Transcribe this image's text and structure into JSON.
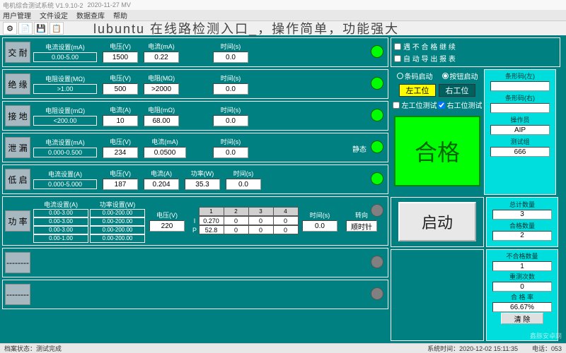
{
  "window": {
    "title": "电机综合测试系统 V1.9.10-2",
    "date": "2020-11-27 MV"
  },
  "menu": {
    "user": "用户管理",
    "file": "文件设定",
    "data": "数据查库",
    "help": "帮助"
  },
  "banner": "lubuntu 在线路检测入口_，操作简单，功能强大",
  "rows": {
    "jiaonai": {
      "name": "交 耐",
      "set_lbl": "电流设置(mA)",
      "set_val": "0.00-5.00",
      "volt_lbl": "电压(V)",
      "volt": "1500",
      "cur_lbl": "电流(mA)",
      "cur": "0.22",
      "time_lbl": "时间(s)",
      "time": "0.0"
    },
    "jueyuan": {
      "name": "绝 缘",
      "set_lbl": "电阻设置(MΩ)",
      "set_val": ">1.00",
      "volt_lbl": "电压(V)",
      "volt": "500",
      "res_lbl": "电阻(MΩ)",
      "res": ">2000",
      "time_lbl": "时间(s)",
      "time": "0.0"
    },
    "jiedi": {
      "name": "接 地",
      "set_lbl": "电阻设置(mΩ)",
      "set_val": "<200.00",
      "cur_lbl": "电流(A)",
      "cur": "10",
      "res_lbl": "电阻(mΩ)",
      "res": "68.00",
      "time_lbl": "时间(s)",
      "time": "0.0"
    },
    "xielou": {
      "name": "泄 漏",
      "set_lbl": "电流设置(mA)",
      "set_val": "0.000-0.500",
      "volt_lbl": "电压(V)",
      "volt": "234",
      "cur_lbl": "电流(mA)",
      "cur": "0.0500",
      "time_lbl": "时间(s)",
      "time": "0.0",
      "static": "静态"
    },
    "diqi": {
      "name": "低 启",
      "set_lbl": "电流设置(A)",
      "set_val": "0.000-5.000",
      "volt_lbl": "电压(V)",
      "volt": "187",
      "cur_lbl": "电流(A)",
      "cur": "0.204",
      "pow_lbl": "功率(W)",
      "pow": "35.3",
      "time_lbl": "时间(s)",
      "time": "0.0"
    },
    "gonglv": {
      "name": "功 率",
      "sets": {
        "c_lbl": "电流设置(A)",
        "p_lbl": "功率设置(W)",
        "r1c": "0.00-3.00",
        "r1p": "0.00-200.00",
        "r2c": "0.00-3.00",
        "r2p": "0.00-200.00",
        "r3c": "0.00-3.00",
        "r3p": "0.00-200.00",
        "r4c": "0.00-1.00",
        "r4p": "0.00-200.00"
      },
      "volt_lbl": "电压(V)",
      "volt": "220",
      "tbl": {
        "h1": "1",
        "h2": "2",
        "h3": "3",
        "h4": "4",
        "Ilbl": "I",
        "Plbl": "P",
        "I1": "0.270",
        "I2": "0",
        "I3": "0",
        "I4": "0",
        "P1": "52.8",
        "P2": "0",
        "P3": "0",
        "P4": "0"
      },
      "time_lbl": "时间(s)",
      "time": "0.0",
      "rot_lbl": "转向",
      "rot": "顺时针"
    },
    "empty": "--------"
  },
  "options": {
    "cont": "遇 不 合 格 继 续",
    "export": "自 动 导 出 报 表",
    "barcode": "条码启动",
    "button": "按钮启动"
  },
  "station": {
    "left": "左工位",
    "right": "右工位",
    "lt": "左工位测试",
    "rt": "右工位测试"
  },
  "result": "合格",
  "start": "启动",
  "side": {
    "bl_lbl": "条形码(左)",
    "bl": "",
    "br_lbl": "条形码(右)",
    "br": "",
    "op_lbl": "操作员",
    "op": "AIP",
    "grp_lbl": "测试组",
    "grp": "666",
    "total_lbl": "总计数量",
    "total": "3",
    "pass_lbl": "合格数量",
    "pass": "2",
    "fail_lbl": "不合格数量",
    "fail": "1",
    "retest_lbl": "重测次数",
    "retest": "0",
    "rate_lbl": "合 格 率",
    "rate": "66.67%",
    "clear": "清 除"
  },
  "status": {
    "doc": "档案状态：测试完成",
    "time": "系统时间：2020-12-02 15:11:35",
    "tel": "电话：053"
  },
  "watermark": "鑫豚安卓网"
}
